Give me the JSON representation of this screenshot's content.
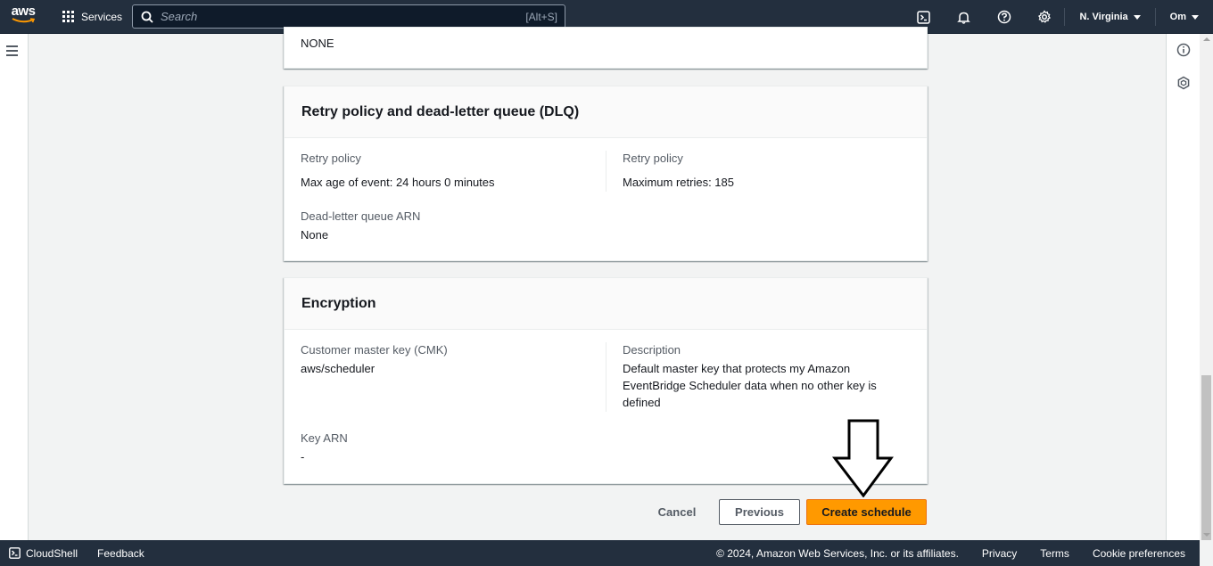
{
  "nav": {
    "logo": "aws",
    "services_label": "Services",
    "search_placeholder": "Search",
    "search_shortcut": "[Alt+S]",
    "region": "N. Virginia",
    "user": "Om",
    "icons": [
      "cloudshell-icon",
      "bell-icon",
      "help-icon",
      "gear-icon"
    ]
  },
  "partial_card": {
    "value": "NONE"
  },
  "retry_card": {
    "title": "Retry policy and dead-letter queue (DLQ)",
    "left_label": "Retry policy",
    "left_value": "Max age of event: 24 hours 0 minutes",
    "right_label": "Retry policy",
    "right_value": "Maximum retries: 185",
    "dlq_label": "Dead-letter queue ARN",
    "dlq_value": "None"
  },
  "encryption_card": {
    "title": "Encryption",
    "cmk_label": "Customer master key (CMK)",
    "cmk_value": "aws/scheduler",
    "desc_label": "Description",
    "desc_value": "Default master key that protects my Amazon EventBridge Scheduler data when no other key is defined",
    "arn_label": "Key ARN",
    "arn_value": "-"
  },
  "actions": {
    "cancel": "Cancel",
    "previous": "Previous",
    "create": "Create schedule"
  },
  "footer": {
    "cloudshell": "CloudShell",
    "feedback": "Feedback",
    "copyright": "© 2024, Amazon Web Services, Inc. or its affiliates.",
    "privacy": "Privacy",
    "terms": "Terms",
    "cookies": "Cookie preferences"
  },
  "colors": {
    "nav_bg": "#232f3e",
    "primary_button": "#ff9900",
    "page_bg": "#f2f3f3"
  }
}
